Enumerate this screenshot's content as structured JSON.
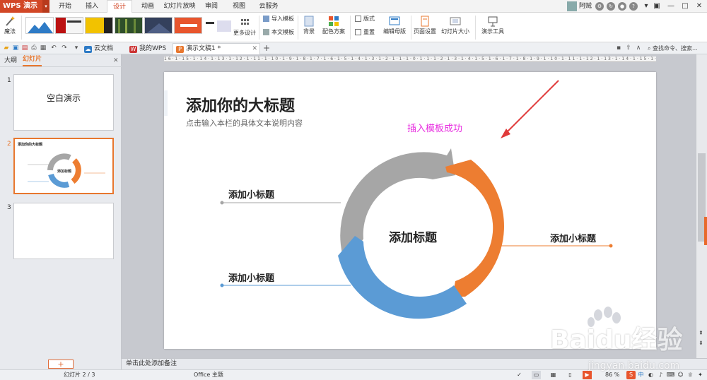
{
  "app": {
    "name": "WPS 演示"
  },
  "menu_tabs": [
    "开始",
    "插入",
    "设计",
    "动画",
    "幻灯片放映",
    "审阅",
    "视图",
    "云服务"
  ],
  "active_menu_tab": "设计",
  "user": {
    "name": "阿贼"
  },
  "ribbon": {
    "magic_label": "魔法",
    "more_design": "更多设计",
    "import_template": "导入模板",
    "text_template": "本文模板",
    "background": "背景",
    "color_scheme": "配色方案",
    "layout": "版式",
    "reset": "重置",
    "edit_master": "编辑母版",
    "page_setup": "页面设置",
    "slide_size": "幻灯片大小",
    "presentation_tools": "演示工具"
  },
  "doc_tabs": [
    {
      "label": "云文档",
      "icon": "cloud-icon"
    },
    {
      "label": "我的WPS",
      "icon": "wps-icon"
    },
    {
      "label": "演示文稿1 *",
      "icon": "presentation-icon"
    }
  ],
  "search_placeholder": "查找命令、搜索...",
  "left_panel": {
    "tab_outline": "大纲",
    "tab_slides": "幻灯片",
    "slides": [
      {
        "number": "1",
        "title": "空白演示"
      },
      {
        "number": "2",
        "title": "添加你的大标题",
        "center": "添加标题"
      },
      {
        "number": "3",
        "title": ""
      }
    ]
  },
  "slide": {
    "title": "添加你的大标题",
    "subtitle": "点击输入本栏的具体文本说明内容",
    "annotation": "插入模板成功",
    "center_label": "添加标题",
    "sub_titles": [
      "添加小标题",
      "添加小标题",
      "添加小标题"
    ],
    "colors": {
      "gray": "#a6a6a6",
      "orange": "#ed7d31",
      "blue": "#5b9bd5",
      "annotation": "#e82fe0",
      "arrow": "#e03a3a"
    }
  },
  "ruler_text": "16·1·15·1·14·1·13·1·12·1·11·1·10·1·9·1·8·1·7·1·6·1·5·1·4·1·3·1·2·1·1·1·0·1·1·1·2·1·3·1·4·1·5·1·6·1·7·1·8·1·9·1·10·1·11·1·12·1·13·1·14·1·15·1·16",
  "notes_placeholder": "单击此处添加备注",
  "status": {
    "slide_counter": "幻灯片 2 / 3",
    "theme": "Office 主题",
    "zoom": "86 %"
  },
  "watermark": {
    "text": "Baidu经验",
    "url": "jingyan.baidu.com"
  }
}
